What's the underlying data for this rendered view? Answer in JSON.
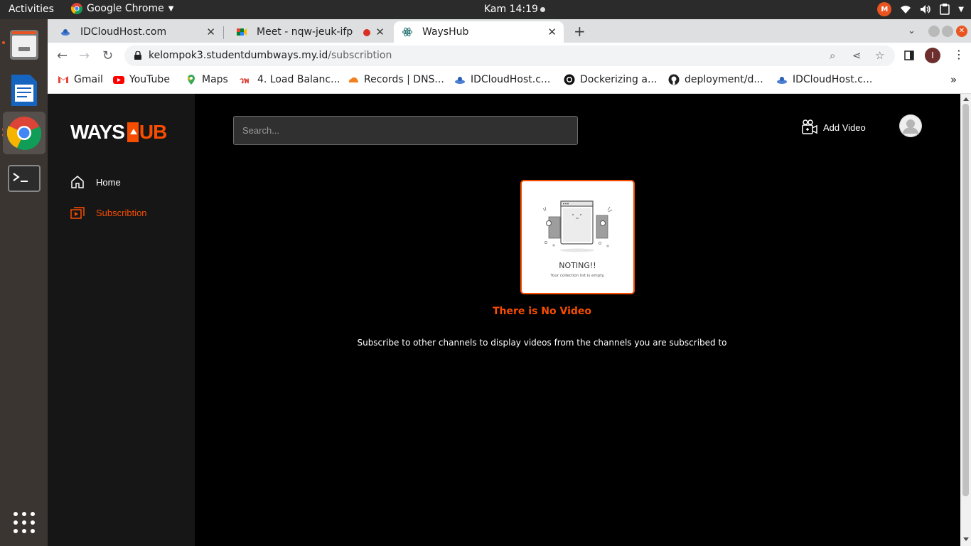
{
  "system": {
    "activities": "Activities",
    "app_menu": "Google Chrome",
    "clock": "Kam 14:19"
  },
  "tabs": [
    {
      "title": "IDCloudHost.com"
    },
    {
      "title": "Meet - nqw-jeuk-ifp"
    },
    {
      "title": "WaysHub"
    }
  ],
  "toolbar": {
    "url_host": "kelompok3.studentdumbways.my.id",
    "url_path": "/subscribtion",
    "profile_initial": "I"
  },
  "bookmarks": [
    {
      "label": "Gmail"
    },
    {
      "label": "YouTube"
    },
    {
      "label": "Maps"
    },
    {
      "label": "4. Load Balanc..."
    },
    {
      "label": "Records | DNS..."
    },
    {
      "label": "IDCloudHost.c..."
    },
    {
      "label": "Dockerizing a..."
    },
    {
      "label": "deployment/d..."
    },
    {
      "label": "IDCloudHost.c..."
    }
  ],
  "app": {
    "logo_left": "WAYS",
    "logo_right": "UB",
    "nav": [
      {
        "label": "Home"
      },
      {
        "label": "Subscribtion"
      }
    ],
    "search_placeholder": "Search...",
    "add_video": "Add Video",
    "empty_card_title": "NOTING!!",
    "empty_card_sub": "Your collection list is empty.",
    "empty_title": "There is No Video",
    "empty_sub": "Subscribe to other channels to display videos from the channels you are subscribed to"
  },
  "colors": {
    "accent": "#f74d00",
    "sidebar_bg": "#161616",
    "page_bg": "#000000"
  }
}
